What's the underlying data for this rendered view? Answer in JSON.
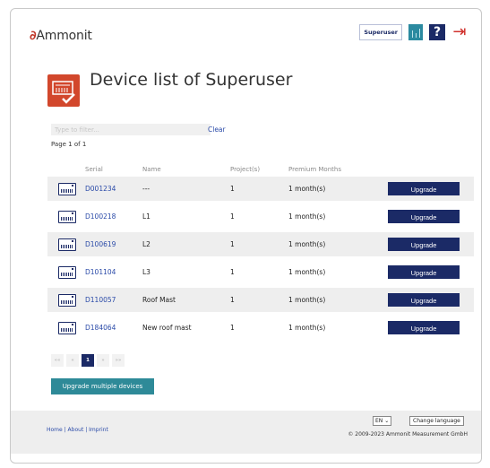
{
  "header": {
    "logo_text": "Ammonit",
    "user_button": "Superuser",
    "help_icon": "?",
    "logout_icon": "logout-icon"
  },
  "page": {
    "title": "Device list of Superuser",
    "icon": "device-list-icon"
  },
  "filter": {
    "placeholder": "Type to filter...",
    "value": "",
    "clear_label": "Clear",
    "page_info": "Page 1 of 1"
  },
  "table": {
    "headers": [
      "Serial",
      "Name",
      "Project(s)",
      "Premium Months"
    ],
    "rows": [
      {
        "serial": "D001234",
        "name": "---",
        "projects": "1",
        "months": "1 month(s)",
        "action": "Upgrade"
      },
      {
        "serial": "D100218",
        "name": "L1",
        "projects": "1",
        "months": "1 month(s)",
        "action": "Upgrade"
      },
      {
        "serial": "D100619",
        "name": "L2",
        "projects": "1",
        "months": "1 month(s)",
        "action": "Upgrade"
      },
      {
        "serial": "D101104",
        "name": "L3",
        "projects": "1",
        "months": "1 month(s)",
        "action": "Upgrade"
      },
      {
        "serial": "D110057",
        "name": "Roof Mast",
        "projects": "1",
        "months": "1 month(s)",
        "action": "Upgrade"
      },
      {
        "serial": "D184064",
        "name": "New roof mast",
        "projects": "1",
        "months": "1 month(s)",
        "action": "Upgrade"
      }
    ]
  },
  "pagination": {
    "first": "««",
    "prev": "«",
    "current": "1",
    "next": "»",
    "last": "»»"
  },
  "actions": {
    "upgrade_multiple": "Upgrade multiple devices"
  },
  "footer": {
    "links": "Home | About | Imprint",
    "language_value": "EN",
    "change_language": "Change language",
    "copyright": "© 2009-2023 Ammonit Measurement GmbH"
  },
  "colors": {
    "brand_navy": "#1b2a66",
    "accent_red": "#d2472c",
    "teal": "#2e8a98"
  }
}
